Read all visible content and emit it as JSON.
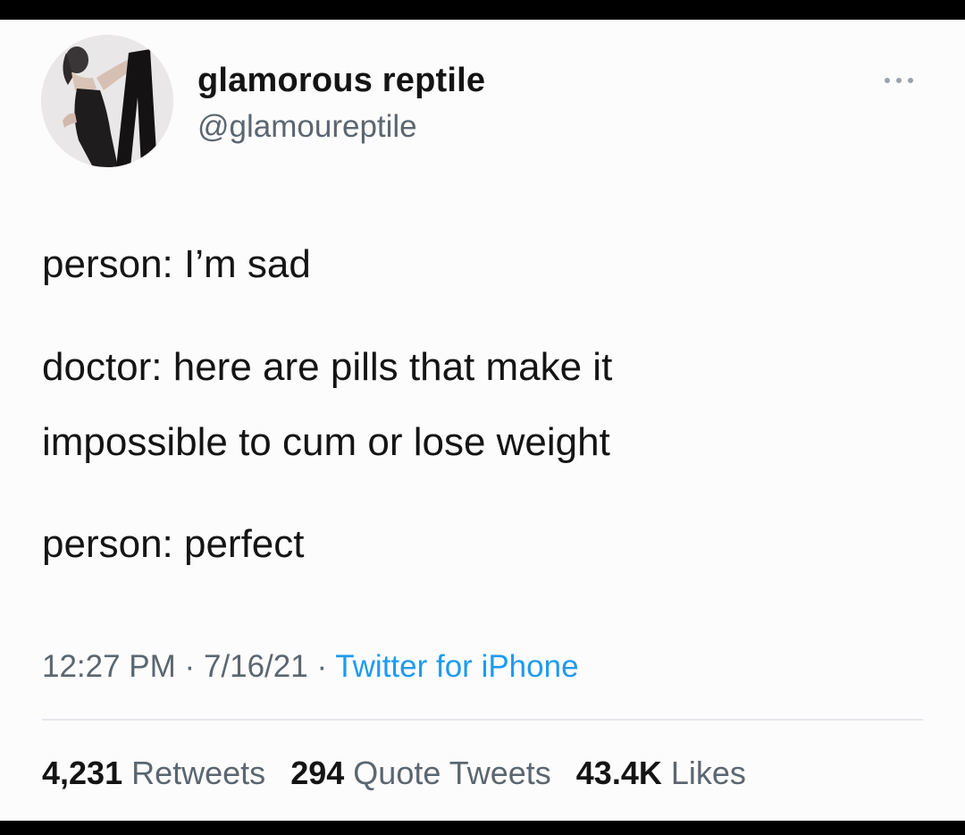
{
  "tweet": {
    "author": {
      "display_name": "glamorous reptile",
      "handle": "@glamoureptile"
    },
    "text_lines": [
      "person: I’m sad",
      "doctor: here are pills that make it",
      "impossible to cum or lose weight",
      "person: perfect"
    ],
    "time": "12:27 PM",
    "date": "7/16/21",
    "separator": "·",
    "source": "Twitter for iPhone",
    "stats": {
      "retweets_count": "4,231",
      "retweets_label": "Retweets",
      "quotes_count": "294",
      "quotes_label": "Quote Tweets",
      "likes_count": "43.4K",
      "likes_label": "Likes"
    }
  },
  "icons": {
    "more": "more-options-icon"
  },
  "colors": {
    "background": "#fdfcfd",
    "frame": "#000000",
    "text": "#141414",
    "secondary_text": "#5b6670",
    "link": "#1d9bf0",
    "divider": "#e4e7ea"
  }
}
